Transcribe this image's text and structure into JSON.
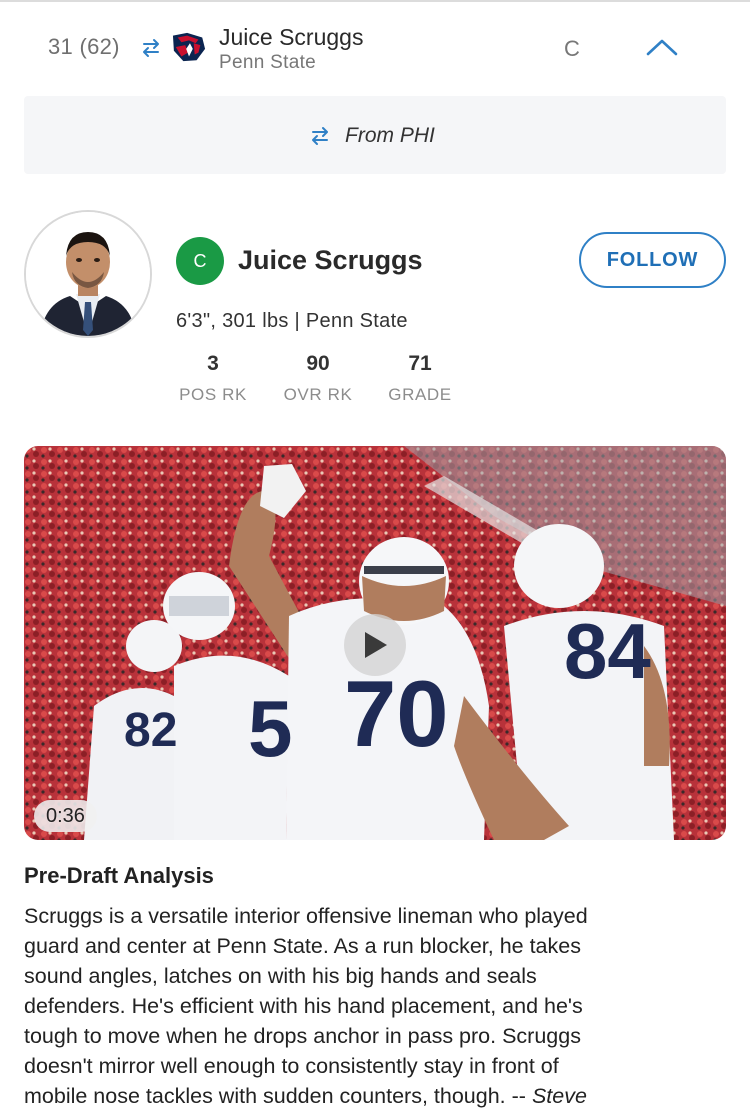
{
  "header": {
    "pick": "31 (62)",
    "player_name": "Juice Scruggs",
    "school": "Penn State",
    "position": "C",
    "trade_icon": "swap-arrows-icon",
    "team_logo": "texans-logo",
    "collapse_icon": "chevron-up-icon"
  },
  "trade_banner": {
    "text": "From PHI"
  },
  "player": {
    "position_badge": "C",
    "name": "Juice Scruggs",
    "follow_label": "FOLLOW",
    "bio": "6'3\", 301 lbs | Penn State",
    "stats": [
      {
        "value": "3",
        "label": "POS RK"
      },
      {
        "value": "90",
        "label": "OVR RK"
      },
      {
        "value": "71",
        "label": "GRADE"
      }
    ]
  },
  "video": {
    "duration": "0:36",
    "jersey_numbers": [
      "82",
      "5",
      "70",
      "84"
    ]
  },
  "analysis": {
    "title": "Pre-Draft Analysis",
    "lines": [
      "Scruggs is a versatile interior offensive lineman who played",
      "guard and center at Penn State. As a run blocker, he takes",
      "sound angles, latches on with his big hands and seals",
      "defenders. He's efficient with his hand placement, and he's",
      "tough to move when he drops anchor in pass pro. Scruggs",
      "doesn't mirror well enough to consistently stay in front of",
      "mobile nose tackles with sudden counters, though. --"
    ],
    "author": "Steve"
  },
  "colors": {
    "accent_blue": "#2f80c6",
    "position_green": "#1a9a45",
    "banner_bg": "#f5f6f8"
  }
}
